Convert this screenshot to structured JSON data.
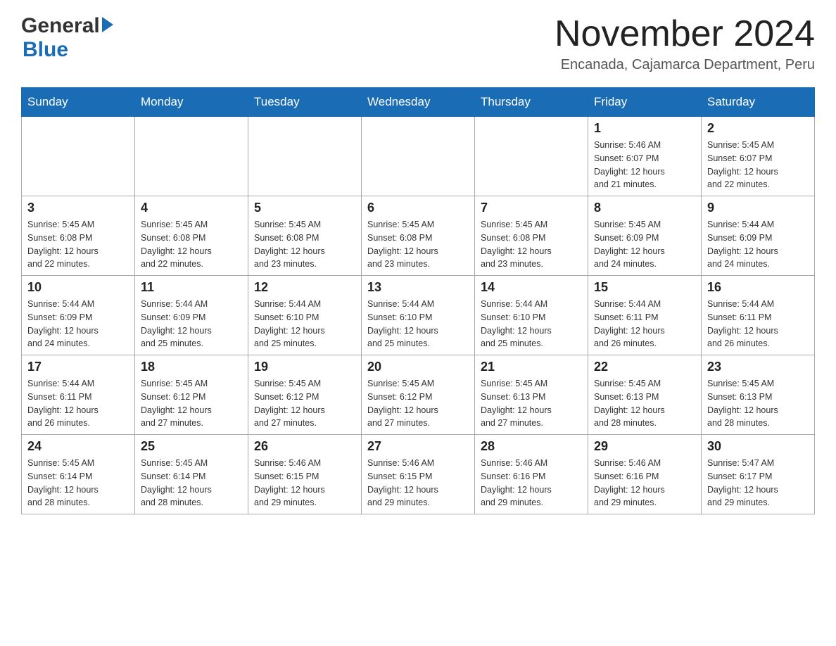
{
  "header": {
    "logo_general": "General",
    "logo_blue": "Blue",
    "month_title": "November 2024",
    "location": "Encanada, Cajamarca Department, Peru"
  },
  "weekdays": [
    "Sunday",
    "Monday",
    "Tuesday",
    "Wednesday",
    "Thursday",
    "Friday",
    "Saturday"
  ],
  "weeks": [
    [
      {
        "day": "",
        "info": ""
      },
      {
        "day": "",
        "info": ""
      },
      {
        "day": "",
        "info": ""
      },
      {
        "day": "",
        "info": ""
      },
      {
        "day": "",
        "info": ""
      },
      {
        "day": "1",
        "info": "Sunrise: 5:46 AM\nSunset: 6:07 PM\nDaylight: 12 hours\nand 21 minutes."
      },
      {
        "day": "2",
        "info": "Sunrise: 5:45 AM\nSunset: 6:07 PM\nDaylight: 12 hours\nand 22 minutes."
      }
    ],
    [
      {
        "day": "3",
        "info": "Sunrise: 5:45 AM\nSunset: 6:08 PM\nDaylight: 12 hours\nand 22 minutes."
      },
      {
        "day": "4",
        "info": "Sunrise: 5:45 AM\nSunset: 6:08 PM\nDaylight: 12 hours\nand 22 minutes."
      },
      {
        "day": "5",
        "info": "Sunrise: 5:45 AM\nSunset: 6:08 PM\nDaylight: 12 hours\nand 23 minutes."
      },
      {
        "day": "6",
        "info": "Sunrise: 5:45 AM\nSunset: 6:08 PM\nDaylight: 12 hours\nand 23 minutes."
      },
      {
        "day": "7",
        "info": "Sunrise: 5:45 AM\nSunset: 6:08 PM\nDaylight: 12 hours\nand 23 minutes."
      },
      {
        "day": "8",
        "info": "Sunrise: 5:45 AM\nSunset: 6:09 PM\nDaylight: 12 hours\nand 24 minutes."
      },
      {
        "day": "9",
        "info": "Sunrise: 5:44 AM\nSunset: 6:09 PM\nDaylight: 12 hours\nand 24 minutes."
      }
    ],
    [
      {
        "day": "10",
        "info": "Sunrise: 5:44 AM\nSunset: 6:09 PM\nDaylight: 12 hours\nand 24 minutes."
      },
      {
        "day": "11",
        "info": "Sunrise: 5:44 AM\nSunset: 6:09 PM\nDaylight: 12 hours\nand 25 minutes."
      },
      {
        "day": "12",
        "info": "Sunrise: 5:44 AM\nSunset: 6:10 PM\nDaylight: 12 hours\nand 25 minutes."
      },
      {
        "day": "13",
        "info": "Sunrise: 5:44 AM\nSunset: 6:10 PM\nDaylight: 12 hours\nand 25 minutes."
      },
      {
        "day": "14",
        "info": "Sunrise: 5:44 AM\nSunset: 6:10 PM\nDaylight: 12 hours\nand 25 minutes."
      },
      {
        "day": "15",
        "info": "Sunrise: 5:44 AM\nSunset: 6:11 PM\nDaylight: 12 hours\nand 26 minutes."
      },
      {
        "day": "16",
        "info": "Sunrise: 5:44 AM\nSunset: 6:11 PM\nDaylight: 12 hours\nand 26 minutes."
      }
    ],
    [
      {
        "day": "17",
        "info": "Sunrise: 5:44 AM\nSunset: 6:11 PM\nDaylight: 12 hours\nand 26 minutes."
      },
      {
        "day": "18",
        "info": "Sunrise: 5:45 AM\nSunset: 6:12 PM\nDaylight: 12 hours\nand 27 minutes."
      },
      {
        "day": "19",
        "info": "Sunrise: 5:45 AM\nSunset: 6:12 PM\nDaylight: 12 hours\nand 27 minutes."
      },
      {
        "day": "20",
        "info": "Sunrise: 5:45 AM\nSunset: 6:12 PM\nDaylight: 12 hours\nand 27 minutes."
      },
      {
        "day": "21",
        "info": "Sunrise: 5:45 AM\nSunset: 6:13 PM\nDaylight: 12 hours\nand 27 minutes."
      },
      {
        "day": "22",
        "info": "Sunrise: 5:45 AM\nSunset: 6:13 PM\nDaylight: 12 hours\nand 28 minutes."
      },
      {
        "day": "23",
        "info": "Sunrise: 5:45 AM\nSunset: 6:13 PM\nDaylight: 12 hours\nand 28 minutes."
      }
    ],
    [
      {
        "day": "24",
        "info": "Sunrise: 5:45 AM\nSunset: 6:14 PM\nDaylight: 12 hours\nand 28 minutes."
      },
      {
        "day": "25",
        "info": "Sunrise: 5:45 AM\nSunset: 6:14 PM\nDaylight: 12 hours\nand 28 minutes."
      },
      {
        "day": "26",
        "info": "Sunrise: 5:46 AM\nSunset: 6:15 PM\nDaylight: 12 hours\nand 29 minutes."
      },
      {
        "day": "27",
        "info": "Sunrise: 5:46 AM\nSunset: 6:15 PM\nDaylight: 12 hours\nand 29 minutes."
      },
      {
        "day": "28",
        "info": "Sunrise: 5:46 AM\nSunset: 6:16 PM\nDaylight: 12 hours\nand 29 minutes."
      },
      {
        "day": "29",
        "info": "Sunrise: 5:46 AM\nSunset: 6:16 PM\nDaylight: 12 hours\nand 29 minutes."
      },
      {
        "day": "30",
        "info": "Sunrise: 5:47 AM\nSunset: 6:17 PM\nDaylight: 12 hours\nand 29 minutes."
      }
    ]
  ]
}
